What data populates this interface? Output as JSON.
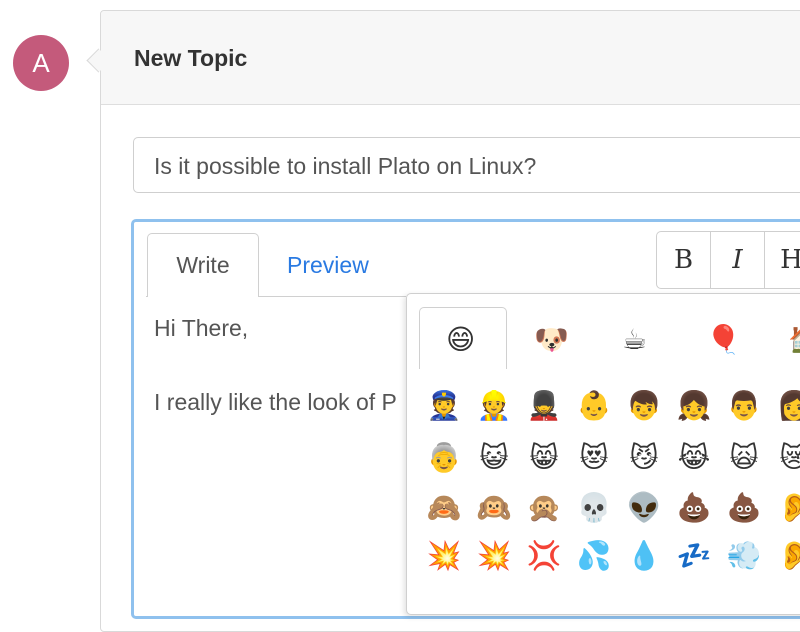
{
  "user": {
    "avatar_letter": "A",
    "avatar_color": "#c45a7b"
  },
  "panel": {
    "title": "New Topic"
  },
  "topic": {
    "title_value": "Is it possible to install Plato on Linux?"
  },
  "editor": {
    "tabs": {
      "write": "Write",
      "preview": "Preview"
    },
    "toolbar": {
      "bold": "B",
      "italic": "I",
      "heading": "H"
    },
    "body": {
      "line1": "Hi There,",
      "line2": "I really like the look of P"
    }
  },
  "emoji_picker": {
    "categories": [
      {
        "name": "smileys",
        "glyph": "😄",
        "active": true
      },
      {
        "name": "animals",
        "glyph": "🐶",
        "active": false
      },
      {
        "name": "food",
        "glyph": "☕",
        "active": false
      },
      {
        "name": "activities",
        "glyph": "🎈",
        "active": false
      },
      {
        "name": "travel",
        "glyph": "🏠",
        "active": false
      }
    ],
    "rows": [
      [
        "👮",
        "👷",
        "💂",
        "👶",
        "👦",
        "👧",
        "👨",
        "👩"
      ],
      [
        "👵",
        "😺",
        "😸",
        "😻",
        "😼",
        "😹",
        "🙀",
        "😿"
      ],
      [
        "🙈",
        "🙉",
        "🙊",
        "💀",
        "👽",
        "💩",
        "💩",
        "👂"
      ],
      [
        "💥",
        "💥",
        "💢",
        "💦",
        "💧",
        "💤",
        "💨",
        "👂"
      ]
    ]
  },
  "colors": {
    "accent": "#2a7ae2",
    "focus_border": "#8fc1ee"
  }
}
